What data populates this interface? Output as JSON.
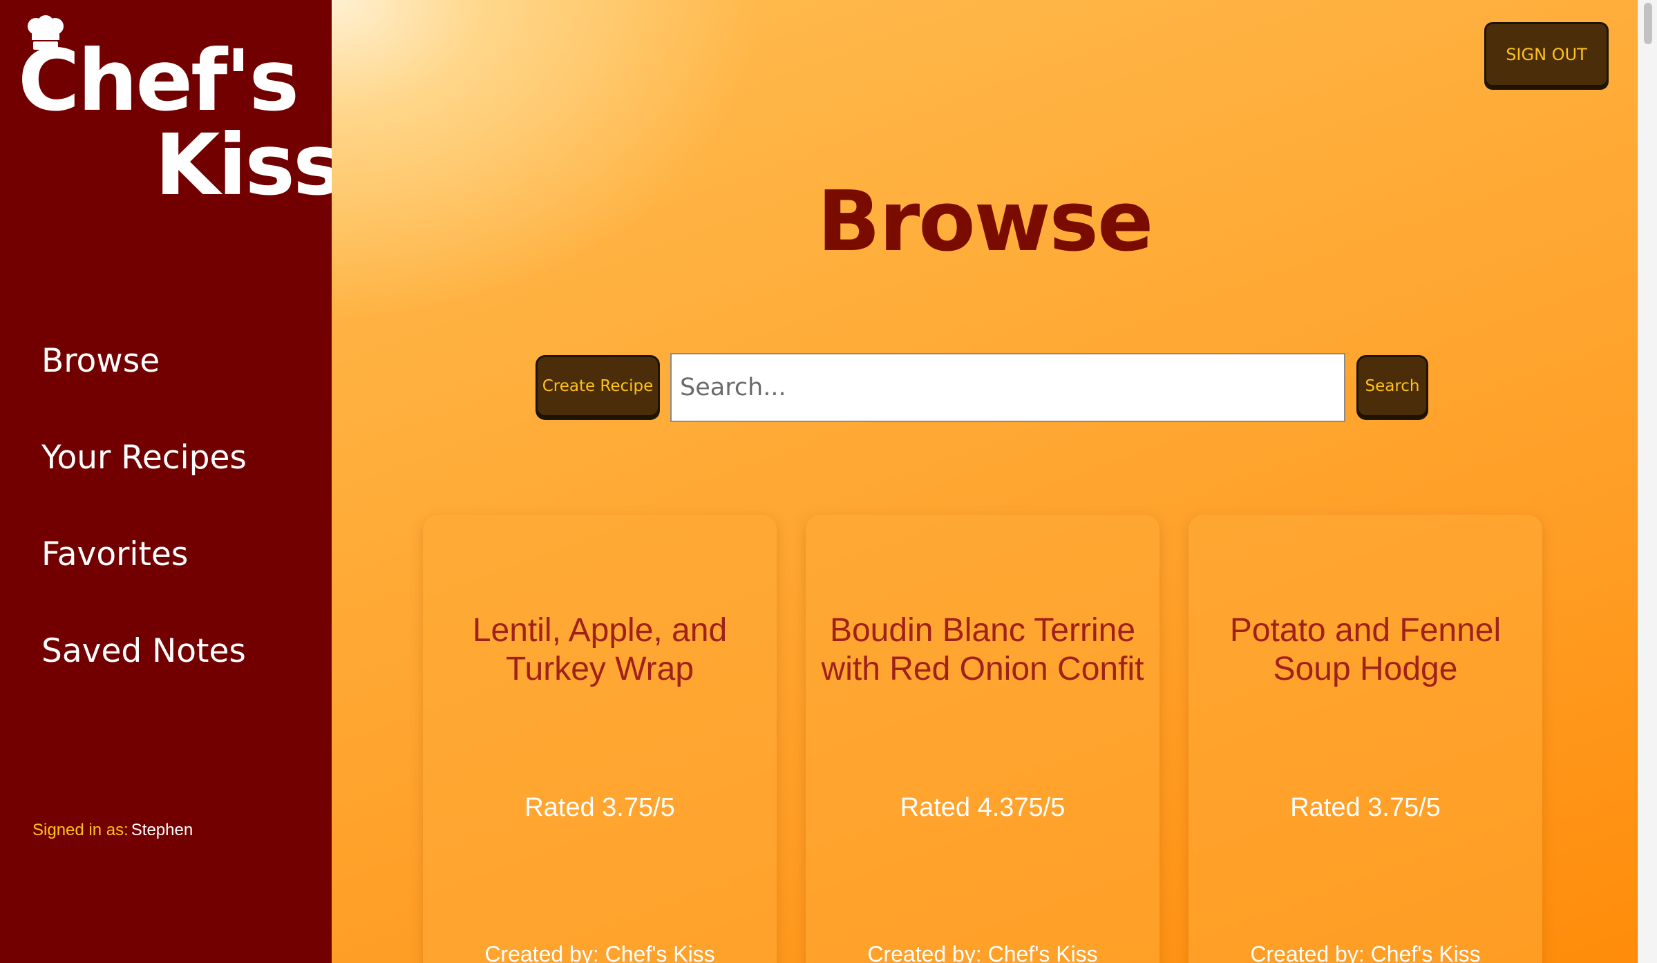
{
  "app": {
    "logo_line1": "Chef's",
    "logo_line2": "Kiss"
  },
  "sidebar": {
    "items": [
      {
        "label": "Browse"
      },
      {
        "label": "Your Recipes"
      },
      {
        "label": "Favorites"
      },
      {
        "label": "Saved Notes"
      }
    ],
    "signed_in_label": "Signed in as:",
    "signed_in_user": "Stephen"
  },
  "header": {
    "signout_label": "SIGN OUT",
    "title": "Browse"
  },
  "toolbar": {
    "create_label": "Create Recipe",
    "search_placeholder": "Search...",
    "search_label": "Search"
  },
  "recipes": [
    {
      "title": "Lentil, Apple, and Turkey Wrap",
      "rating": "Rated 3.75/5",
      "creator": "Created by: Chef's Kiss"
    },
    {
      "title": "Boudin Blanc Terrine with Red Onion Confit",
      "rating": "Rated 4.375/5",
      "creator": "Created by: Chef's Kiss"
    },
    {
      "title": "Potato and Fennel Soup Hodge",
      "rating": "Rated 3.75/5",
      "creator": "Created by: Chef's Kiss"
    }
  ],
  "colors": {
    "sidebar": "#730000",
    "accent": "#ffc21a",
    "button": "#4b2e09",
    "title": "#7a0b00",
    "card_title": "#a0201a"
  }
}
